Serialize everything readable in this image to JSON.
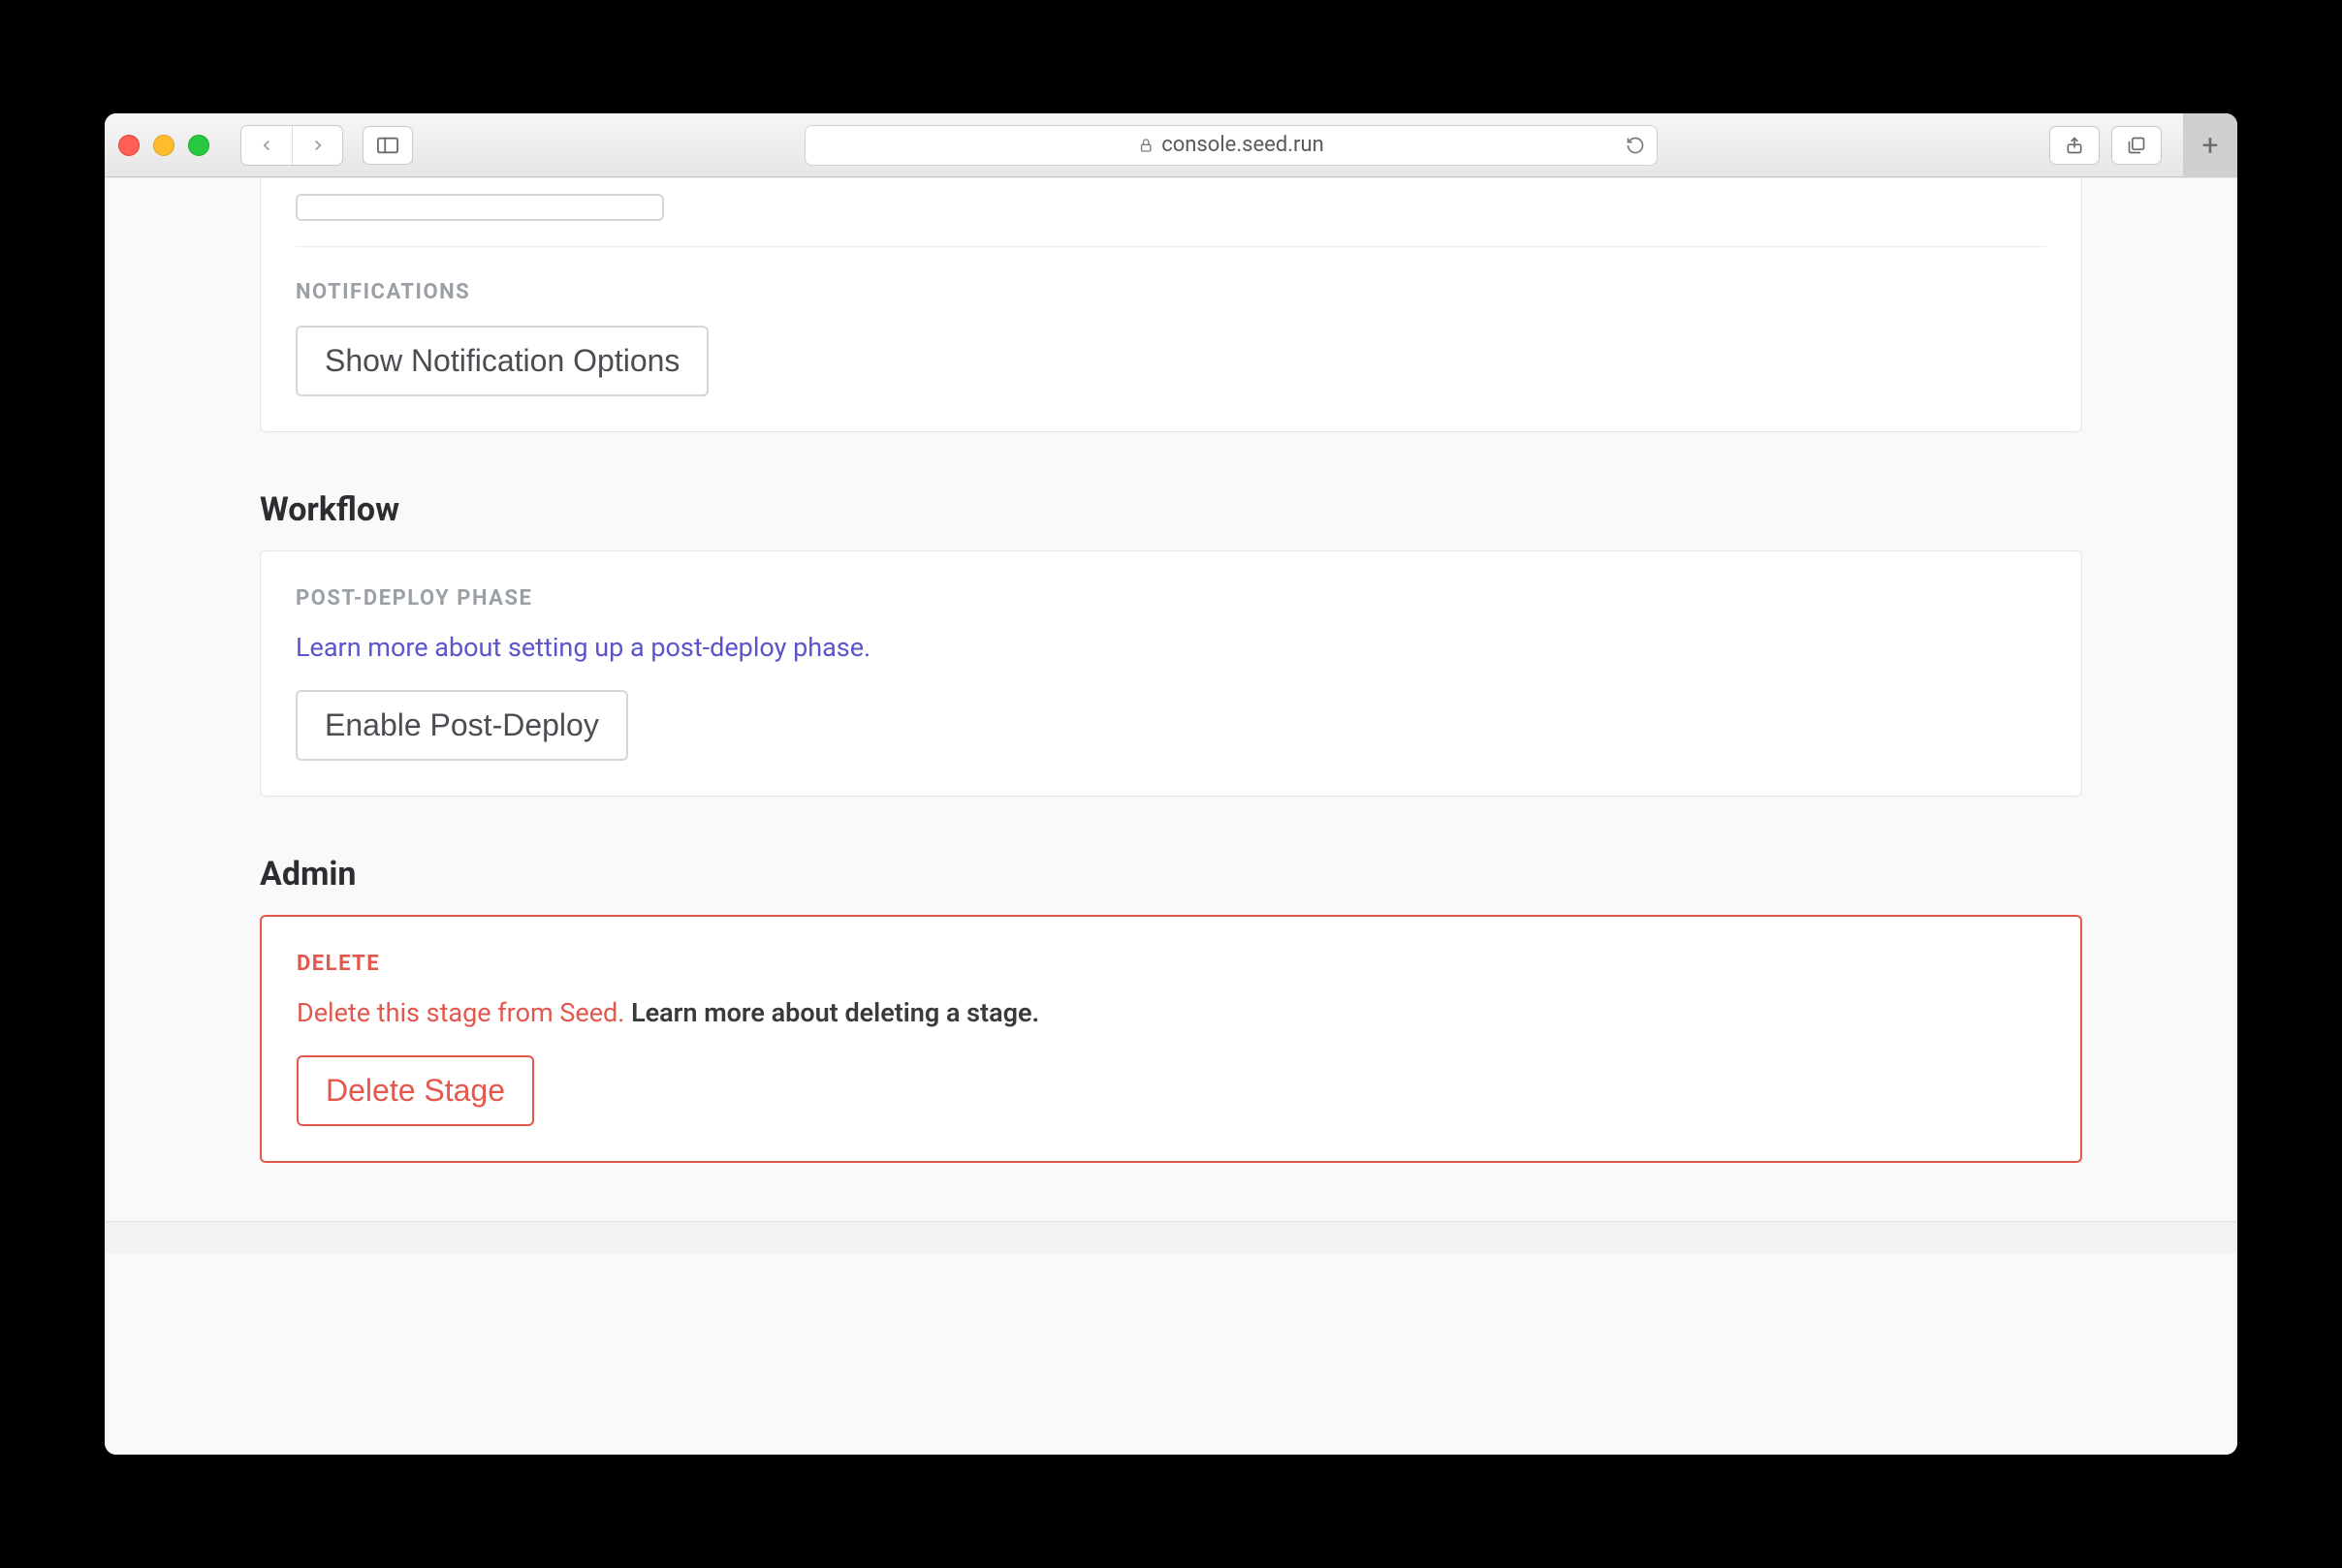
{
  "browser": {
    "url": "console.seed.run"
  },
  "notifications": {
    "label": "NOTIFICATIONS",
    "button": "Show Notification Options"
  },
  "workflow": {
    "heading": "Workflow",
    "subheading": "POST-DEPLOY PHASE",
    "learn_link": "Learn more about setting up a post-deploy phase.",
    "button": "Enable Post-Deploy"
  },
  "admin": {
    "heading": "Admin",
    "subheading": "DELETE",
    "desc": "Delete this stage from Seed.",
    "learn_link": "Learn more about deleting a stage.",
    "button": "Delete Stage"
  }
}
